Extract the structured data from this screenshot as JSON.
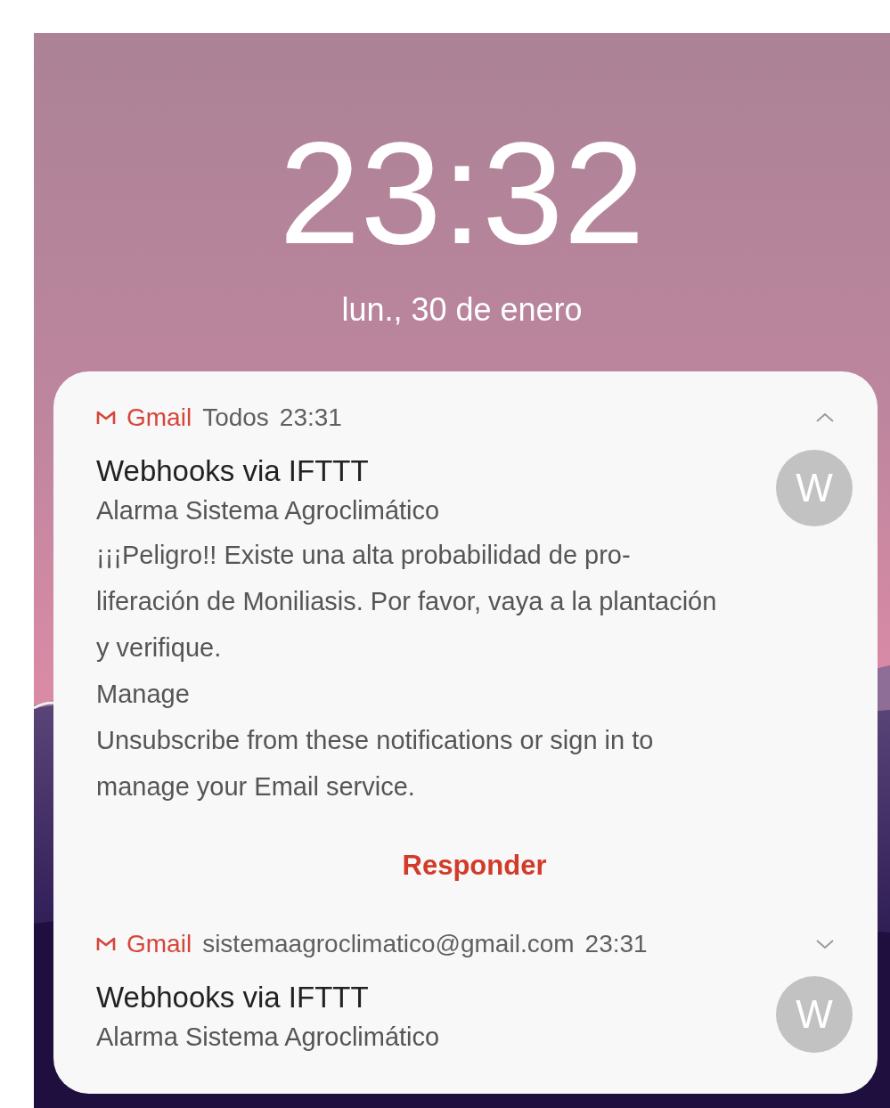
{
  "lock_screen": {
    "time": "23:32",
    "date": "lun., 30 de enero"
  },
  "notifications": [
    {
      "app": "Gmail",
      "detail": "Todos",
      "time": "23:31",
      "expanded": true,
      "sender": "Webhooks via IFTTT",
      "subject": "Alarma Sistema Agroclimático",
      "avatar_letter": "W",
      "body": [
        {
          "lines": [
            "¡¡¡Peligro!! Existe una alta probabilidad de pro-",
            "liferación de Moniliasis. Por favor, vaya a la plantación",
            "y verifique."
          ]
        },
        {
          "lines": [
            "Manage"
          ]
        },
        {
          "lines": [
            "Unsubscribe from these notifications or sign in to",
            "manage your Email service."
          ]
        }
      ],
      "action": "Responder"
    },
    {
      "app": "Gmail",
      "detail": "sistemaagroclimatico@gmail.com",
      "time": "23:31",
      "expanded": false,
      "sender": "Webhooks via IFTTT",
      "subject": "Alarma Sistema Agroclimático",
      "avatar_letter": "W"
    }
  ]
}
